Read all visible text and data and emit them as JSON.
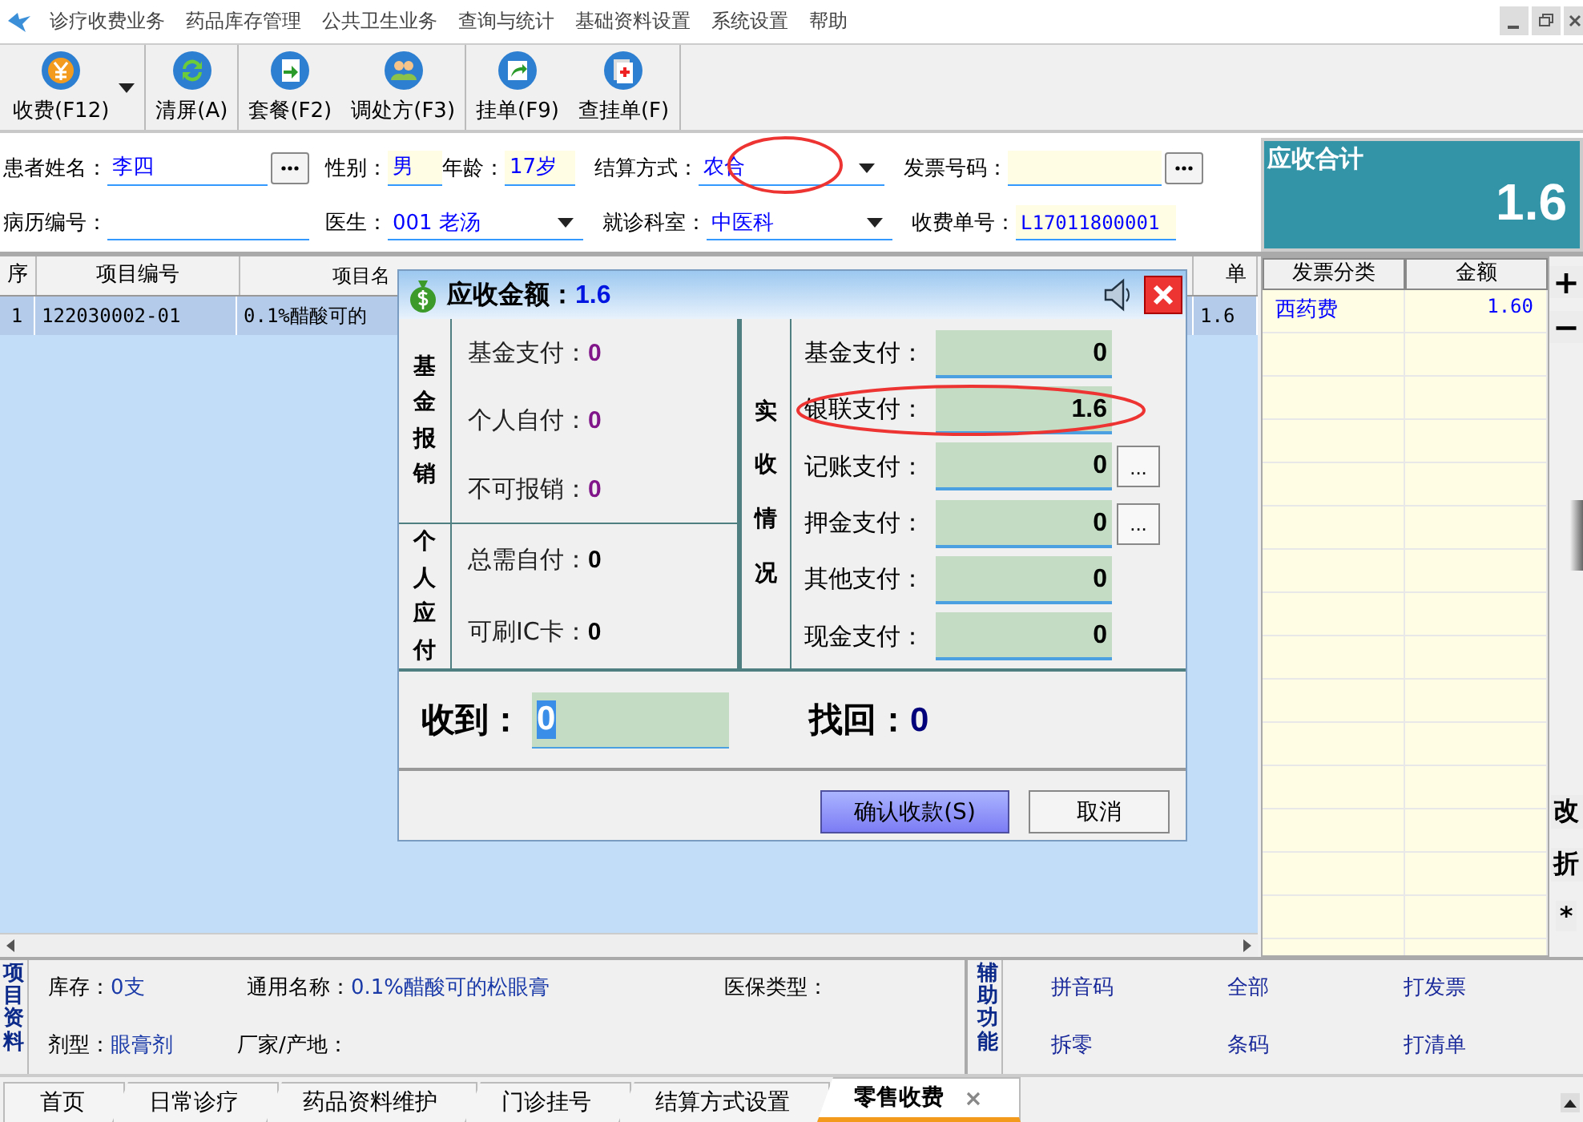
{
  "menu": [
    "诊疗收费业务",
    "药品库存管理",
    "公共卫生业务",
    "查询与统计",
    "基础资料设置",
    "系统设置",
    "帮助"
  ],
  "toolbar": [
    {
      "label": "收费(F12)",
      "kind": "charge",
      "dropdown": true
    },
    {
      "label": "清屏(A)",
      "kind": "refresh",
      "dropdown": false
    },
    {
      "label": "套餐(F2)",
      "kind": "package",
      "dropdown": false
    },
    {
      "label": "调处方(F3)",
      "kind": "people",
      "dropdown": false
    },
    {
      "label": "挂单(F9)",
      "kind": "hold",
      "dropdown": false
    },
    {
      "label": "查挂单(F)",
      "kind": "lookup",
      "dropdown": false
    }
  ],
  "form": {
    "fields": [
      {
        "label": "患者姓名：",
        "value": "李四",
        "kind": "lookup",
        "readonly": false,
        "circled": false
      },
      {
        "label": "性别：",
        "value": "男",
        "kind": "text",
        "readonly": true,
        "circled": false
      },
      {
        "label": "年龄：",
        "value": "17岁",
        "kind": "text",
        "readonly": true,
        "circled": false
      },
      {
        "label": "结算方式：",
        "value": "农合",
        "kind": "combo",
        "readonly": false,
        "circled": true
      },
      {
        "label": "发票号码：",
        "kind": "lookup",
        "readonly": true,
        "circled": false
      },
      {
        "label": "病历编号：",
        "kind": "text",
        "readonly": false,
        "circled": false
      },
      {
        "label": "医生：",
        "value": "001 老汤",
        "kind": "combo",
        "readonly": false,
        "circled": false
      },
      {
        "label": "就诊科室：",
        "value": "中医科",
        "kind": "combo",
        "readonly": false,
        "circled": false
      },
      {
        "label": "收费单号：",
        "value": "L17011800001",
        "kind": "text",
        "readonly": true,
        "circled": false
      }
    ]
  },
  "total": {
    "label": "应收合计",
    "value": "1.6"
  },
  "table": {
    "columns": [
      "序",
      "项目编号",
      "项目名",
      "单"
    ],
    "rows": [
      {
        "cells": [
          "1",
          "122030002-01",
          "0.1%醋酸可的",
          "1.6"
        ],
        "selected": true
      }
    ]
  },
  "invoice": {
    "columns": [
      "发票分类",
      "金额"
    ],
    "rows": [
      [
        "西药费",
        "1.60"
      ]
    ]
  },
  "side_tools": [
    "+",
    "−",
    "改",
    "折",
    "*"
  ],
  "dialog": {
    "title": "应收金额：",
    "amount": "1.6",
    "sections": [
      {
        "heading": "基金报销",
        "kind": "fund",
        "items": [
          {
            "label": "基金支付：",
            "value": "0"
          },
          {
            "label": "个人自付：",
            "value": "0"
          },
          {
            "label": "不可报销：",
            "value": "0"
          }
        ]
      },
      {
        "heading": "个人应付",
        "kind": "personal",
        "items": [
          {
            "label": "总需自付：",
            "value": "0"
          },
          {
            "label": "可刷IC卡：",
            "value": "0"
          }
        ]
      }
    ],
    "actual": {
      "heading": "实收情况",
      "items": [
        {
          "label": "基金支付：",
          "value": "0",
          "circled": false
        },
        {
          "label": "银联支付：",
          "value": "1.6",
          "circled": true
        },
        {
          "label": "记账支付：",
          "value": "0",
          "circled": false,
          "button": "..."
        },
        {
          "label": "押金支付：",
          "value": "0",
          "circled": false,
          "button": "..."
        },
        {
          "label": "其他支付：",
          "value": "0",
          "circled": false
        },
        {
          "label": "现金支付：",
          "value": "0",
          "circled": false
        }
      ]
    },
    "received": {
      "label": "收到：",
      "value": "0"
    },
    "change": {
      "label": "找回：",
      "value": "0"
    },
    "buttons": [
      {
        "label": "确认收款(S)",
        "primary": true
      },
      {
        "label": "取消",
        "primary": false
      }
    ]
  },
  "info": {
    "heading": "项目资料",
    "rows": [
      [
        {
          "label": "库存：",
          "value": "0支"
        },
        {
          "label": "通用名称：",
          "value": "0.1%醋酸可的松眼膏"
        },
        {
          "label": "医保类型："
        }
      ],
      [
        {
          "label": "剂型：",
          "value": "眼膏剂"
        },
        {
          "label": "厂家/产地："
        }
      ]
    ]
  },
  "aux": {
    "heading": "辅助功能",
    "links": [
      "拼音码",
      "全部",
      "打发票",
      "拆零",
      "条码",
      "打清单"
    ]
  },
  "tabs": [
    {
      "label": "首页",
      "selected": false
    },
    {
      "label": "日常诊疗",
      "selected": false
    },
    {
      "label": "药品资料维护",
      "selected": false
    },
    {
      "label": "门诊挂号",
      "selected": false
    },
    {
      "label": "结算方式设置",
      "selected": false
    },
    {
      "label": "零售收费",
      "selected": true
    }
  ]
}
